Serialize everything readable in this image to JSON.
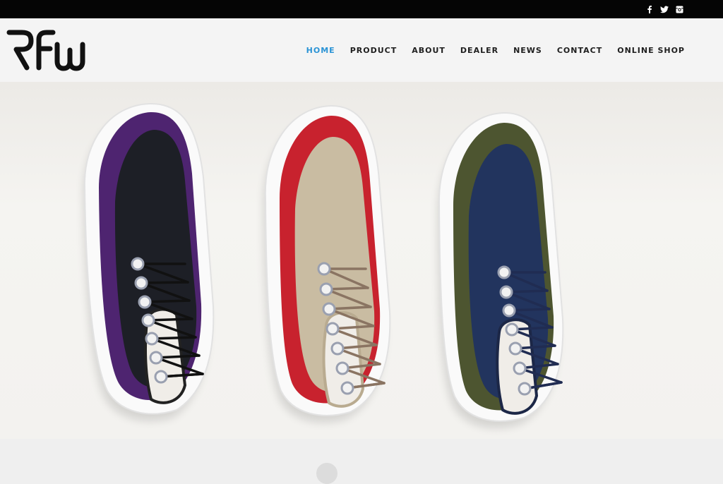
{
  "brand": {
    "logo_text": "RFW"
  },
  "social": [
    {
      "name": "facebook-icon",
      "glyph": "f"
    },
    {
      "name": "twitter-icon",
      "glyph": "t"
    },
    {
      "name": "instagram-icon",
      "glyph": "i"
    }
  ],
  "nav": {
    "items": [
      {
        "label": "HOME",
        "active": true
      },
      {
        "label": "PRODUCT",
        "active": false
      },
      {
        "label": "ABOUT",
        "active": false
      },
      {
        "label": "DEALER",
        "active": false
      },
      {
        "label": "NEWS",
        "active": false
      },
      {
        "label": "CONTACT",
        "active": false
      },
      {
        "label": "ONLINE SHOP",
        "active": false
      }
    ]
  },
  "hero": {
    "shoes": [
      {
        "name": "purple-black-sneaker",
        "accent": "#5a2a7a",
        "body": "#1d1f26",
        "lace": "#111111"
      },
      {
        "name": "red-beige-sneaker",
        "accent": "#c8222e",
        "body": "#c9bca2",
        "lace": "#8a7462"
      },
      {
        "name": "olive-navy-sneaker",
        "accent": "#4d5530",
        "body": "#22345e",
        "lace": "#202c52"
      }
    ]
  },
  "colors": {
    "accent": "#2a93d5",
    "topbar": "#050505",
    "header": "#f4f4f4"
  }
}
